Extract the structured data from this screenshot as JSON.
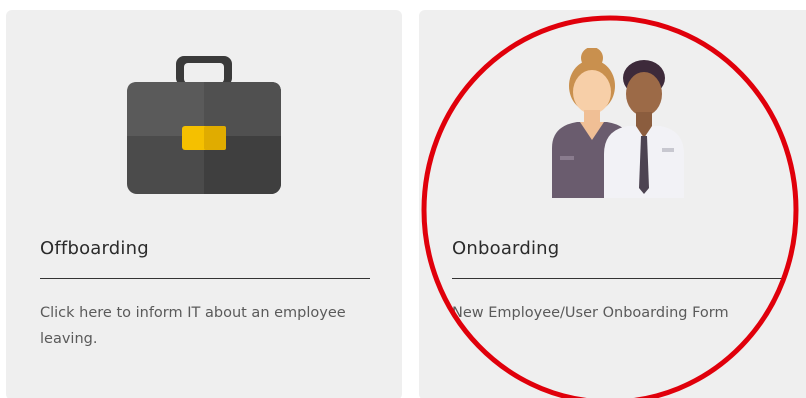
{
  "cards": [
    {
      "title": "Offboarding",
      "description": "Click here to inform IT about an employee leaving.",
      "icon": "briefcase-icon"
    },
    {
      "title": "Onboarding",
      "description": "New Employee/User Onboarding Form",
      "icon": "new-employees-icon"
    }
  ],
  "annotation": {
    "shape": "ellipse",
    "color": "#e0000b",
    "target": "Onboarding"
  },
  "colors": {
    "card_background": "#efefef",
    "briefcase_body": "#4a4a4a",
    "briefcase_clasp": "#f5c000",
    "annotation": "#e0000b"
  }
}
